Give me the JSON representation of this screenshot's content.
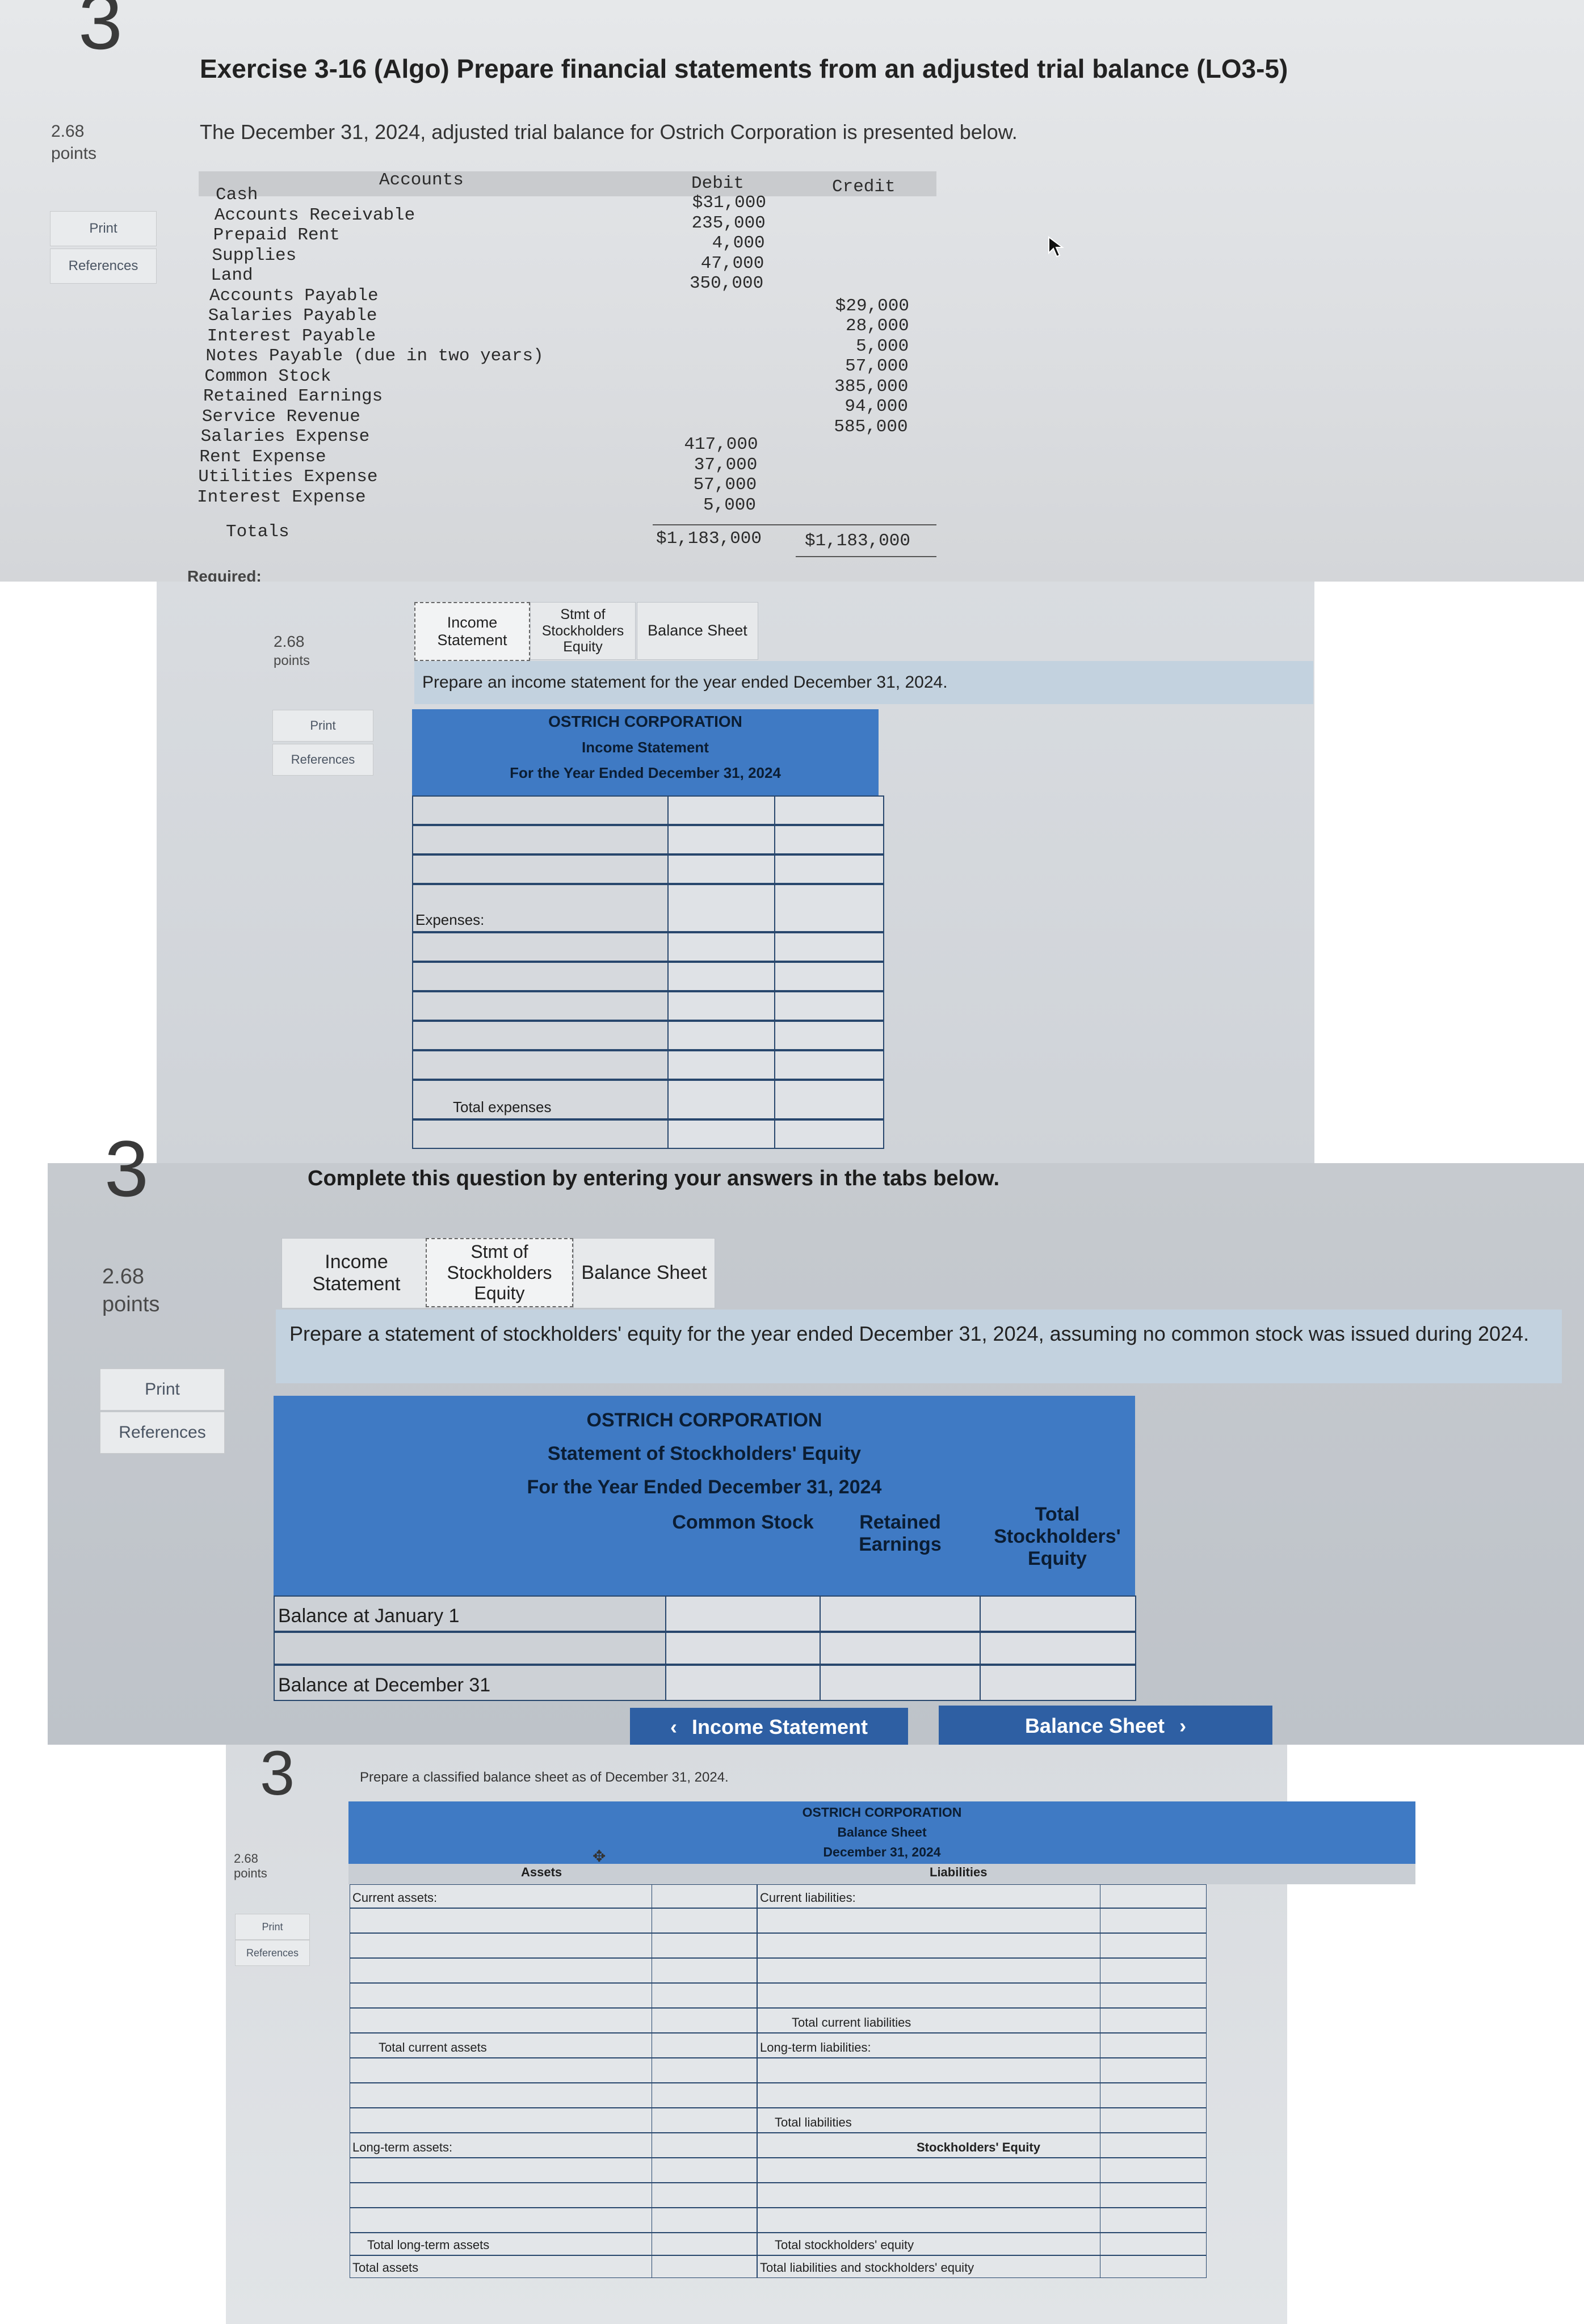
{
  "question_number": "3",
  "points": "2.68",
  "points_unit": "points",
  "side_buttons": {
    "print": "Print",
    "references": "References"
  },
  "exercise_title": "Exercise 3-16 (Algo) Prepare financial statements from an adjusted trial balance (LO3-5)",
  "intro": "The December 31, 2024, adjusted trial balance for Ostrich Corporation is presented below.",
  "trial_balance": {
    "headers": {
      "accounts": "Accounts",
      "debit": "Debit",
      "credit": "Credit"
    },
    "rows": [
      {
        "account": "Cash",
        "debit": "$31,000",
        "credit": ""
      },
      {
        "account": "Accounts Receivable",
        "debit": "235,000",
        "credit": ""
      },
      {
        "account": "Prepaid Rent",
        "debit": "4,000",
        "credit": ""
      },
      {
        "account": "Supplies",
        "debit": "47,000",
        "credit": ""
      },
      {
        "account": "Land",
        "debit": "350,000",
        "credit": ""
      },
      {
        "account": "Accounts Payable",
        "debit": "",
        "credit": "$29,000"
      },
      {
        "account": "Salaries Payable",
        "debit": "",
        "credit": "28,000"
      },
      {
        "account": "Interest Payable",
        "debit": "",
        "credit": "5,000"
      },
      {
        "account": "Notes Payable (due in two years)",
        "debit": "",
        "credit": "57,000"
      },
      {
        "account": "Common Stock",
        "debit": "",
        "credit": "385,000"
      },
      {
        "account": "Retained Earnings",
        "debit": "",
        "credit": "94,000"
      },
      {
        "account": "Service Revenue",
        "debit": "",
        "credit": "585,000"
      },
      {
        "account": "Salaries Expense",
        "debit": "417,000",
        "credit": ""
      },
      {
        "account": "Rent Expense",
        "debit": "37,000",
        "credit": ""
      },
      {
        "account": "Utilities Expense",
        "debit": "57,000",
        "credit": ""
      },
      {
        "account": "Interest Expense",
        "debit": "5,000",
        "credit": ""
      }
    ],
    "totals": {
      "label": "Totals",
      "debit": "$1,183,000",
      "credit": "$1,183,000"
    }
  },
  "required_label": "Required:",
  "tabs": {
    "income_statement": "Income Statement",
    "stmt_equity": "Stmt of Stockholders Equity",
    "balance_sheet": "Balance Sheet"
  },
  "income_statement": {
    "instruction": "Prepare an income statement for the year ended December 31, 2024.",
    "company": "OSTRICH CORPORATION",
    "title": "Income Statement",
    "period": "For the Year Ended December 31, 2024",
    "expenses_label": "Expenses:",
    "total_expenses_label": "Total expenses"
  },
  "complete_msg": "Complete this question by entering your answers in the tabs below.",
  "equity_statement": {
    "instruction": "Prepare a statement of stockholders' equity for the year ended December 31, 2024, assuming no common stock was issued during 2024.",
    "company": "OSTRICH CORPORATION",
    "title": "Statement of Stockholders' Equity",
    "period": "For the Year Ended December 31, 2024",
    "col_common": "Common Stock",
    "col_retained": "Retained Earnings",
    "col_total": "Total Stockholders' Equity",
    "balance_jan": "Balance at January 1",
    "balance_dec": "Balance at December 31"
  },
  "nav": {
    "prev": "Income Statement",
    "next": "Balance Sheet"
  },
  "balance_sheet": {
    "instruction": "Prepare a classified balance sheet as of December 31, 2024.",
    "company": "OSTRICH CORPORATION",
    "title": "Balance Sheet",
    "date": "December 31, 2024",
    "assets": "Assets",
    "liabilities": "Liabilities",
    "current_assets": "Current assets:",
    "total_current_assets": "Total current assets",
    "long_term_assets": "Long-term assets:",
    "total_long_term_assets": "Total long-term assets",
    "total_assets": "Total assets",
    "current_liabilities": "Current liabilities:",
    "total_current_liabilities": "Total current liabilities",
    "long_term_liabilities": "Long-term liabilities:",
    "total_liabilities": "Total liabilities",
    "stockholders_equity": "Stockholders' Equity",
    "total_stockholders_equity": "Total stockholders' equity",
    "total_liab_equity": "Total liabilities and stockholders' equity"
  },
  "colors": {
    "header_blue": "#3f7ac4",
    "border_navy": "#28476d",
    "nav_blue": "#2e5fa3"
  }
}
